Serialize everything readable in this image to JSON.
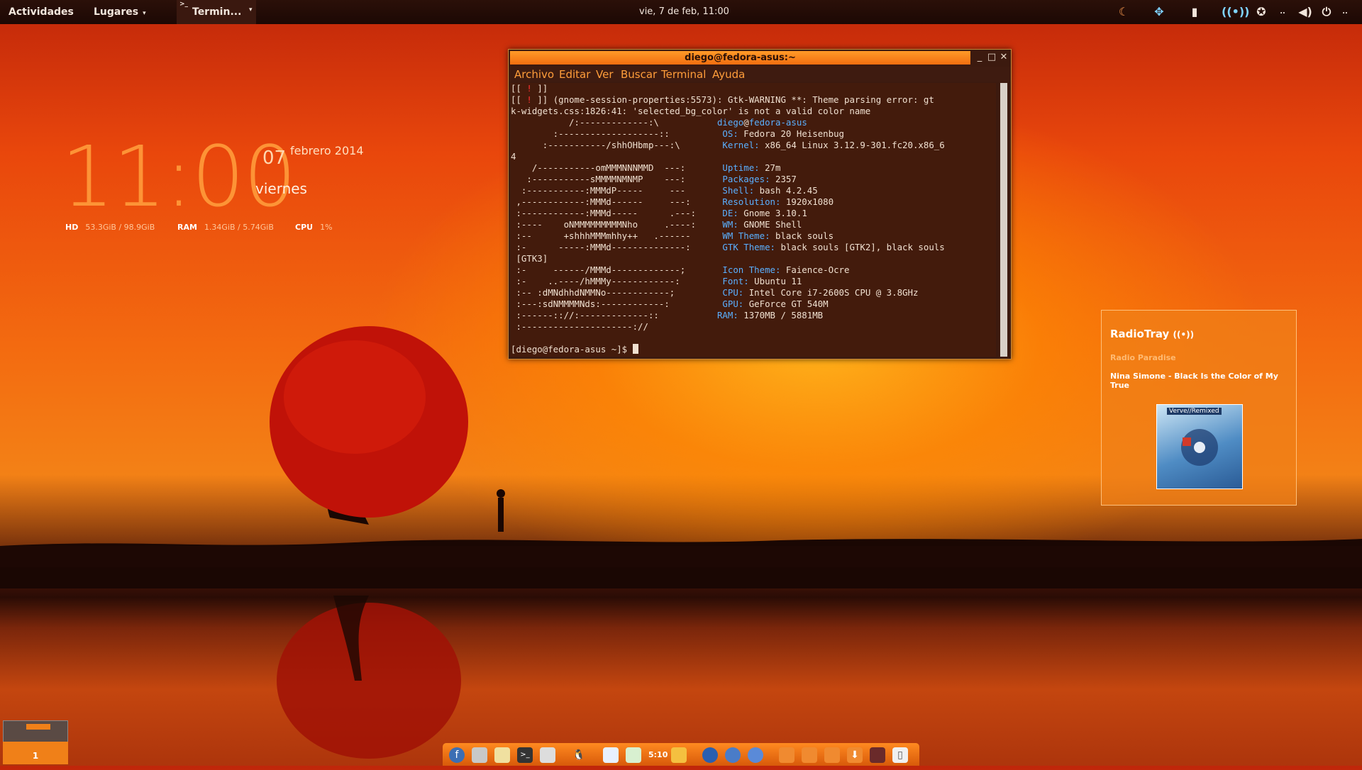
{
  "topbar": {
    "activities": "Actividades",
    "places": "Lugares",
    "app_menu": "Termin...",
    "clock": "vie,  7 de feb, 11:00",
    "tray_icons": [
      "weather-icon",
      "dropbox-icon",
      "device-icon",
      "radio-broadcast-icon",
      "accessibility-icon",
      "volume-icon",
      "power-icon"
    ]
  },
  "desktop_clock": {
    "time": "11:00",
    "day": "07",
    "month_year": "febrero 2014",
    "weekday": "viernes",
    "hd_label": "HD",
    "hd_value": "53.3GiB / 98.9GiB",
    "ram_label": "RAM",
    "ram_value": "1.34GiB / 5.74GiB",
    "cpu_label": "CPU",
    "cpu_value": "1%"
  },
  "terminal": {
    "title": "diego@fedora-asus:~",
    "menu": [
      "Archivo",
      "Editar",
      "Ver",
      "Buscar",
      "Terminal",
      "Ayuda"
    ],
    "lines": [
      [
        "[[ ",
        "! ",
        "]]"
      ],
      [
        "[[ ",
        "! ",
        "]] (gnome-session-properties:5573): Gtk-WARNING **: Theme parsing error: gt"
      ],
      "k-widgets.css:1826:41: 'selected_bg_color' is not a valid color name",
      [
        "           /:-------------:\\           ",
        "diego",
        "@",
        "fedora-asus"
      ],
      [
        "        :-------------------::          ",
        "OS:",
        " Fedora 20 Heisenbug"
      ],
      [
        "      :-----------/shhOHbmp---:\\        ",
        "Kernel:",
        " x86_64 Linux 3.12.9-301.fc20.x86_6"
      ],
      "4",
      [
        "    /-----------omMMMNNNMMD  ---:       ",
        "Uptime:",
        " 27m"
      ],
      [
        "   :-----------sMMMMNMNMP    ---:       ",
        "Packages:",
        " 2357"
      ],
      [
        "  :-----------:MMMdP-----     ---       ",
        "Shell:",
        " bash 4.2.45"
      ],
      [
        " ,------------:MMMd------     ---:      ",
        "Resolution:",
        " 1920x1080"
      ],
      [
        " :------------:MMMd-----      .---:     ",
        "DE:",
        " Gnome 3.10.1"
      ],
      [
        " :----    oNMMMMMMMMMNho     .----:     ",
        "WM:",
        " GNOME Shell"
      ],
      [
        " :--      +shhhMMMmhhy++   .------      ",
        "WM Theme:",
        " black souls"
      ],
      [
        " :-      -----:MMMd--------------:      ",
        "GTK Theme:",
        " black souls [GTK2], black souls"
      ],
      " [GTK3]",
      [
        " :-     ------/MMMd-------------;       ",
        "Icon Theme:",
        " Faience-Ocre"
      ],
      [
        " :-    ..----/hMMMy------------:        ",
        "Font:",
        " Ubuntu 11"
      ],
      [
        " :-- :dMNdhhdNMMNo------------;         ",
        "CPU:",
        " Intel Core i7-2600S CPU @ 3.8GHz"
      ],
      [
        " :---:sdNMMMMNds:------------:          ",
        "GPU:",
        " GeForce GT 540M"
      ],
      [
        " :------:://:-------------::           ",
        "RAM:",
        " 1370MB / 5881MB"
      ],
      " :---------------------://"
    ],
    "prompt": "[diego@fedora-asus ~]$ "
  },
  "radiotray": {
    "title": "RadioTray",
    "station": "Radio Paradise",
    "song": "Nina Simone - Black Is the Color of My True",
    "album_label": "Verve//Remixed"
  },
  "workspace": {
    "number": "1"
  },
  "dock": {
    "clock": "5:10",
    "icons": [
      "fedora-icon",
      "files-icon",
      "text-editor-icon",
      "terminal-icon",
      "calculator-icon",
      "tux-icon",
      "writer-icon",
      "calc-sheet-icon",
      "clock-icon",
      "draw-icon",
      "firefox-icon",
      "chrome-icon",
      "pidgin-icon",
      "folder-icon",
      "folder-icon",
      "folder-icon",
      "download-icon",
      "photos-icon",
      "usb-icon"
    ]
  }
}
